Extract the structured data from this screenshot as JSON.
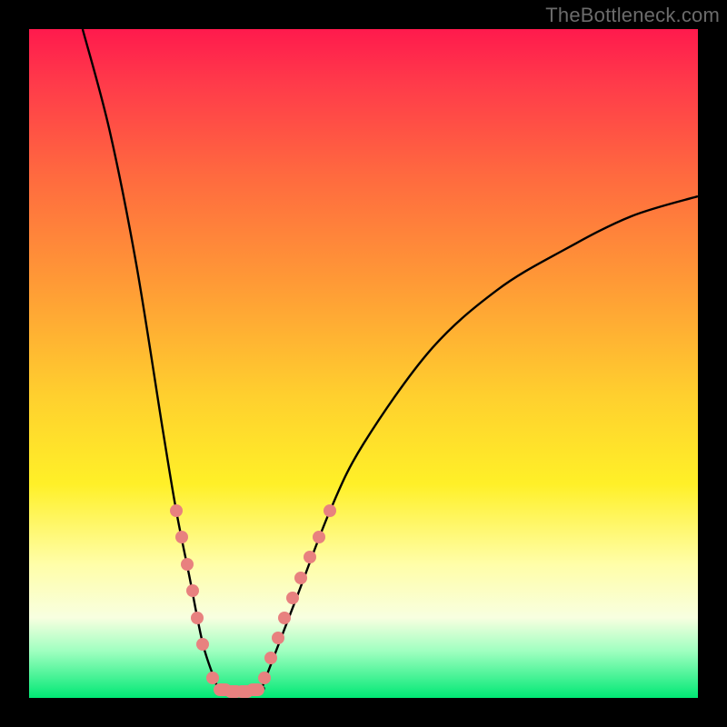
{
  "watermark": "TheBottleneck.com",
  "colors": {
    "frame": "#000000",
    "curve": "#000000",
    "marker": "#e8817f",
    "gradient_stops": [
      "#ff1a4d",
      "#ff3a4a",
      "#ff6a3f",
      "#ff9a36",
      "#ffd02e",
      "#fff028",
      "#fffea8",
      "#f8ffe0",
      "#9fffc0",
      "#00e874"
    ]
  },
  "chart_data": {
    "type": "line",
    "title": "",
    "xlabel": "",
    "ylabel": "",
    "xlim": [
      0,
      100
    ],
    "ylim": [
      0,
      100
    ],
    "grid": false,
    "legend": false,
    "curve": {
      "description": "V-shaped curve: steep left branch falling from y≈100 at x≈8 to y≈0 at x≈28, flat valley y≈0 from x≈28 to x≈35, then right branch rising with decreasing slope to y≈75 at x≈100",
      "left_branch": [
        {
          "x": 8,
          "y": 100
        },
        {
          "x": 12,
          "y": 85
        },
        {
          "x": 16,
          "y": 65
        },
        {
          "x": 20,
          "y": 40
        },
        {
          "x": 22,
          "y": 28
        },
        {
          "x": 24,
          "y": 18
        },
        {
          "x": 26,
          "y": 8
        },
        {
          "x": 28,
          "y": 2
        }
      ],
      "valley": [
        {
          "x": 28,
          "y": 1.5
        },
        {
          "x": 30,
          "y": 0.8
        },
        {
          "x": 32,
          "y": 0.8
        },
        {
          "x": 35,
          "y": 1.5
        }
      ],
      "right_branch": [
        {
          "x": 35,
          "y": 2
        },
        {
          "x": 40,
          "y": 15
        },
        {
          "x": 45,
          "y": 28
        },
        {
          "x": 50,
          "y": 38
        },
        {
          "x": 60,
          "y": 52
        },
        {
          "x": 70,
          "y": 61
        },
        {
          "x": 80,
          "y": 67
        },
        {
          "x": 90,
          "y": 72
        },
        {
          "x": 100,
          "y": 75
        }
      ]
    },
    "markers": {
      "left": [
        {
          "x": 22,
          "y": 28
        },
        {
          "x": 22.8,
          "y": 24
        },
        {
          "x": 23.6,
          "y": 20
        },
        {
          "x": 24.4,
          "y": 16
        },
        {
          "x": 25.2,
          "y": 12
        },
        {
          "x": 26,
          "y": 8
        },
        {
          "x": 27.5,
          "y": 3
        }
      ],
      "bottom": [
        {
          "x": 29,
          "y": 1.2
        },
        {
          "x": 30.6,
          "y": 0.9
        },
        {
          "x": 32.2,
          "y": 0.9
        },
        {
          "x": 33.8,
          "y": 1.2
        }
      ],
      "right": [
        {
          "x": 35.2,
          "y": 3
        },
        {
          "x": 36.2,
          "y": 6
        },
        {
          "x": 37.2,
          "y": 9
        },
        {
          "x": 38.2,
          "y": 12
        },
        {
          "x": 39.4,
          "y": 15
        },
        {
          "x": 40.6,
          "y": 18
        },
        {
          "x": 42,
          "y": 21
        },
        {
          "x": 43.4,
          "y": 24
        },
        {
          "x": 45,
          "y": 28
        }
      ]
    }
  }
}
